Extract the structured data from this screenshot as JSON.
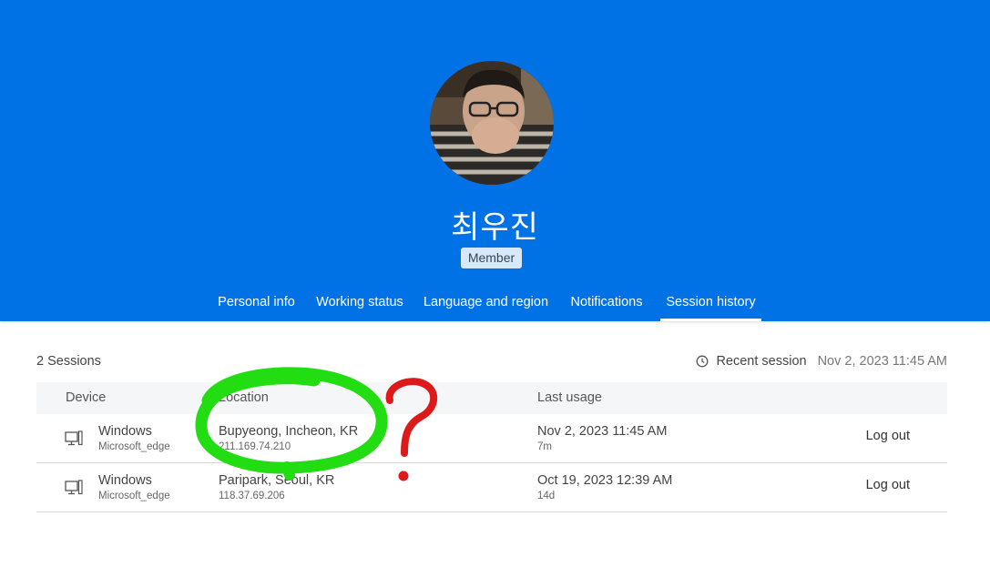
{
  "profile": {
    "name": "최우진",
    "role_badge": "Member"
  },
  "tabs": [
    {
      "label": "Personal info",
      "active": false
    },
    {
      "label": "Working status",
      "active": false
    },
    {
      "label": "Language and region",
      "active": false
    },
    {
      "label": "Notifications",
      "active": false
    },
    {
      "label": "Session history",
      "active": true
    }
  ],
  "sessions_summary": {
    "count_label": "2 Sessions",
    "recent_label": "Recent session",
    "recent_value": "Nov 2, 2023 11:45 AM",
    "icon": "clock-icon"
  },
  "table": {
    "headers": {
      "device": "Device",
      "location": "Location",
      "last_usage": "Last usage"
    },
    "rows": [
      {
        "device": "Windows",
        "browser": "Microsoft_edge",
        "location": "Bupyeong, Incheon, KR",
        "ip": "211.169.74.210",
        "last_usage": "Nov 2, 2023 11:45 AM",
        "ago": "7m",
        "action": "Log out",
        "icon": "desktop-icon"
      },
      {
        "device": "Windows",
        "browser": "Microsoft_edge",
        "location": "Paripark, Seoul, KR",
        "ip": "118.37.69.206",
        "last_usage": "Oct 19, 2023 12:39 AM",
        "ago": "14d",
        "action": "Log out",
        "icon": "desktop-icon"
      }
    ]
  },
  "colors": {
    "header_bg": "#0171e6",
    "annotation_circle": "#22dd11",
    "annotation_question": "#dd1a1a"
  }
}
